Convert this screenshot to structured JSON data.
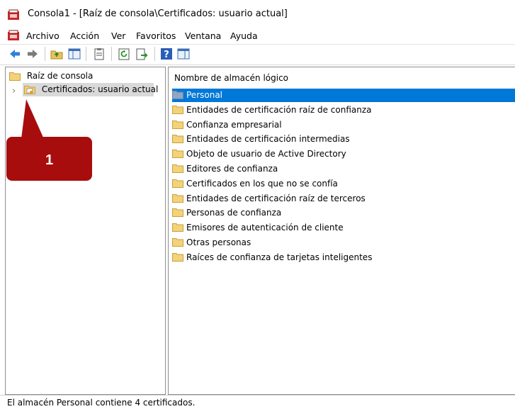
{
  "window": {
    "title": "Consola1 - [Raíz de consola\\Certificados: usuario actual]"
  },
  "menu": {
    "items": [
      "Archivo",
      "Acción",
      "Ver",
      "Favoritos",
      "Ventana",
      "Ayuda"
    ]
  },
  "toolbar": {
    "buttons": [
      "back-icon",
      "forward-icon",
      "up-folder-icon",
      "show-hide-tree-icon",
      "copy-icon",
      "refresh-icon",
      "export-icon",
      "help-icon",
      "properties-icon"
    ]
  },
  "tree": {
    "root_label": "Raíz de consola",
    "child_label": "Certificados: usuario actual",
    "expander": "›"
  },
  "list": {
    "column_header": "Nombre de almacén lógico",
    "selected_index": 0,
    "items": [
      "Personal",
      "Entidades de certificación raíz de confianza",
      "Confianza empresarial",
      "Entidades de certificación intermedias",
      "Objeto de usuario de Active Directory",
      "Editores de confianza",
      "Certificados en los que no se confía",
      "Entidades de certificación raíz de terceros",
      "Personas de confianza",
      "Emisores de autenticación de cliente",
      "Otras personas",
      "Raíces de confianza de tarjetas inteligentes"
    ]
  },
  "callout": {
    "number": "1",
    "color": "#a80d0d"
  },
  "status": {
    "text": "El almacén Personal contiene 4 certificados."
  },
  "colors": {
    "selection": "#0078d7",
    "folder": "#f3d27a"
  }
}
